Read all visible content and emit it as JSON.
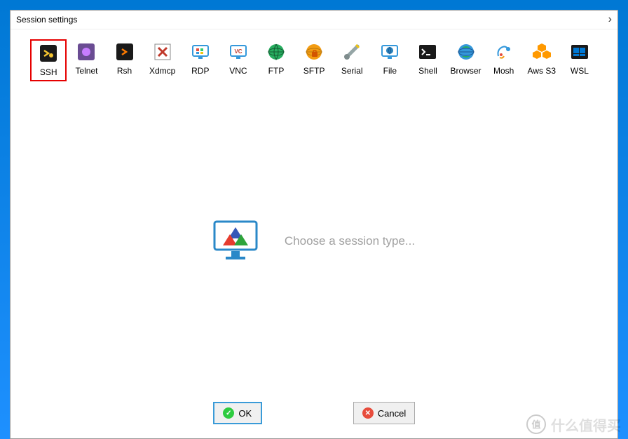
{
  "dialog": {
    "title": "Session settings",
    "prompt": "Choose a session type..."
  },
  "sessions": [
    {
      "id": "ssh",
      "label": "SSH",
      "selected": true
    },
    {
      "id": "telnet",
      "label": "Telnet",
      "selected": false
    },
    {
      "id": "rsh",
      "label": "Rsh",
      "selected": false
    },
    {
      "id": "xdmcp",
      "label": "Xdmcp",
      "selected": false
    },
    {
      "id": "rdp",
      "label": "RDP",
      "selected": false
    },
    {
      "id": "vnc",
      "label": "VNC",
      "selected": false
    },
    {
      "id": "ftp",
      "label": "FTP",
      "selected": false
    },
    {
      "id": "sftp",
      "label": "SFTP",
      "selected": false
    },
    {
      "id": "serial",
      "label": "Serial",
      "selected": false
    },
    {
      "id": "file",
      "label": "File",
      "selected": false
    },
    {
      "id": "shell",
      "label": "Shell",
      "selected": false
    },
    {
      "id": "browser",
      "label": "Browser",
      "selected": false
    },
    {
      "id": "mosh",
      "label": "Mosh",
      "selected": false
    },
    {
      "id": "aws",
      "label": "Aws S3",
      "selected": false
    },
    {
      "id": "wsl",
      "label": "WSL",
      "selected": false
    }
  ],
  "buttons": {
    "ok": "OK",
    "cancel": "Cancel"
  },
  "watermark": "什么值得买"
}
